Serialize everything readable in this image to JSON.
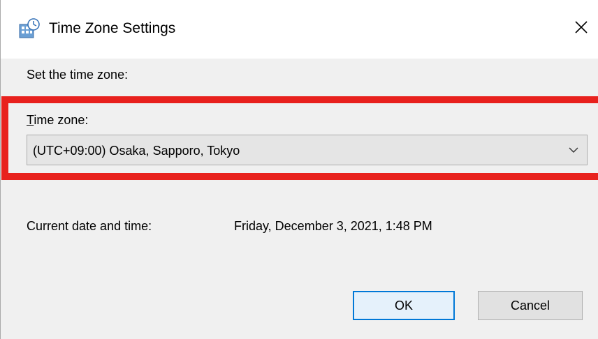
{
  "window": {
    "title": "Time Zone Settings",
    "app_icon": "clock-globe-icon",
    "close_icon": "close-icon"
  },
  "content": {
    "prompt": "Set the time zone:",
    "time_zone_label_accel": "T",
    "time_zone_label_rest": "ime zone:",
    "time_zone_value": "(UTC+09:00) Osaka, Sapporo, Tokyo",
    "dropdown_icon": "chevron-down-icon",
    "highlight_color": "#e8211d",
    "current_label": "Current date and time:",
    "current_value": "Friday, December 3, 2021, 1:48 PM"
  },
  "buttons": {
    "ok_label": "OK",
    "cancel_label": "Cancel"
  }
}
